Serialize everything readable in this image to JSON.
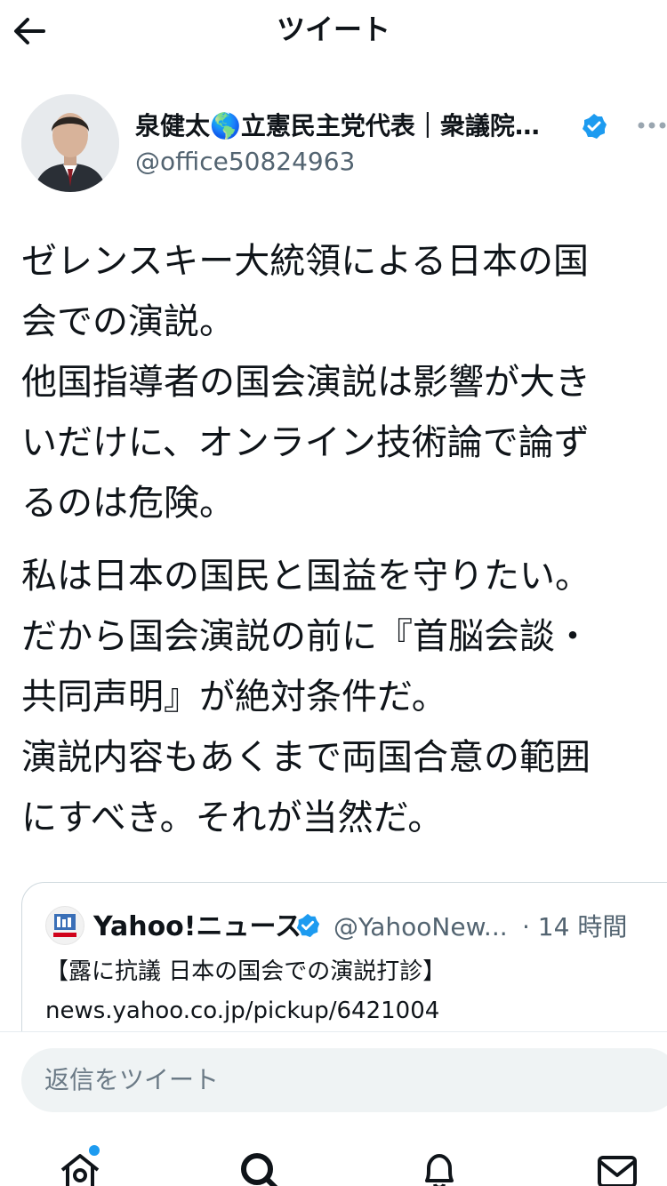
{
  "header": {
    "title": "ツイート",
    "back_icon": "arrow-left-icon"
  },
  "author": {
    "name": "泉健太🌎立憲民主党代表｜衆議院…",
    "handle": "@office50824963",
    "verified": true
  },
  "tweet": {
    "paragraph1": [
      "ゼレンスキー大統領による日本の国",
      "会での演説。",
      "他国指導者の国会演説は影響が大き",
      "いだけに、オンライン技術論で論ず",
      "るのは危険。"
    ],
    "paragraph2": [
      "私は日本の国民と国益を守りたい。",
      "だから国会演説の前に『首脳会談・",
      "共同声明』が絶対条件だ。",
      "演説内容もあくまで両国合意の範囲",
      "にすべき。それが当然だ。"
    ]
  },
  "quoted_tweet": {
    "name": "Yahoo!ニュース",
    "handle": "@YahooNew...",
    "time": "· 14 時間",
    "line1": "【露に抗議 日本の国会での演説打診】",
    "line2": "news.yahoo.co.jp/pickup/6421004"
  },
  "reply": {
    "placeholder": "返信をツイート"
  },
  "nav": {
    "items": [
      "home-icon",
      "search-icon",
      "notifications-icon",
      "messages-icon"
    ],
    "home_has_notification_dot": true
  },
  "colors": {
    "accent": "#1d9bf0",
    "secondary_text": "#536471",
    "border": "#cfd9de",
    "input_bg": "#eff3f4"
  }
}
